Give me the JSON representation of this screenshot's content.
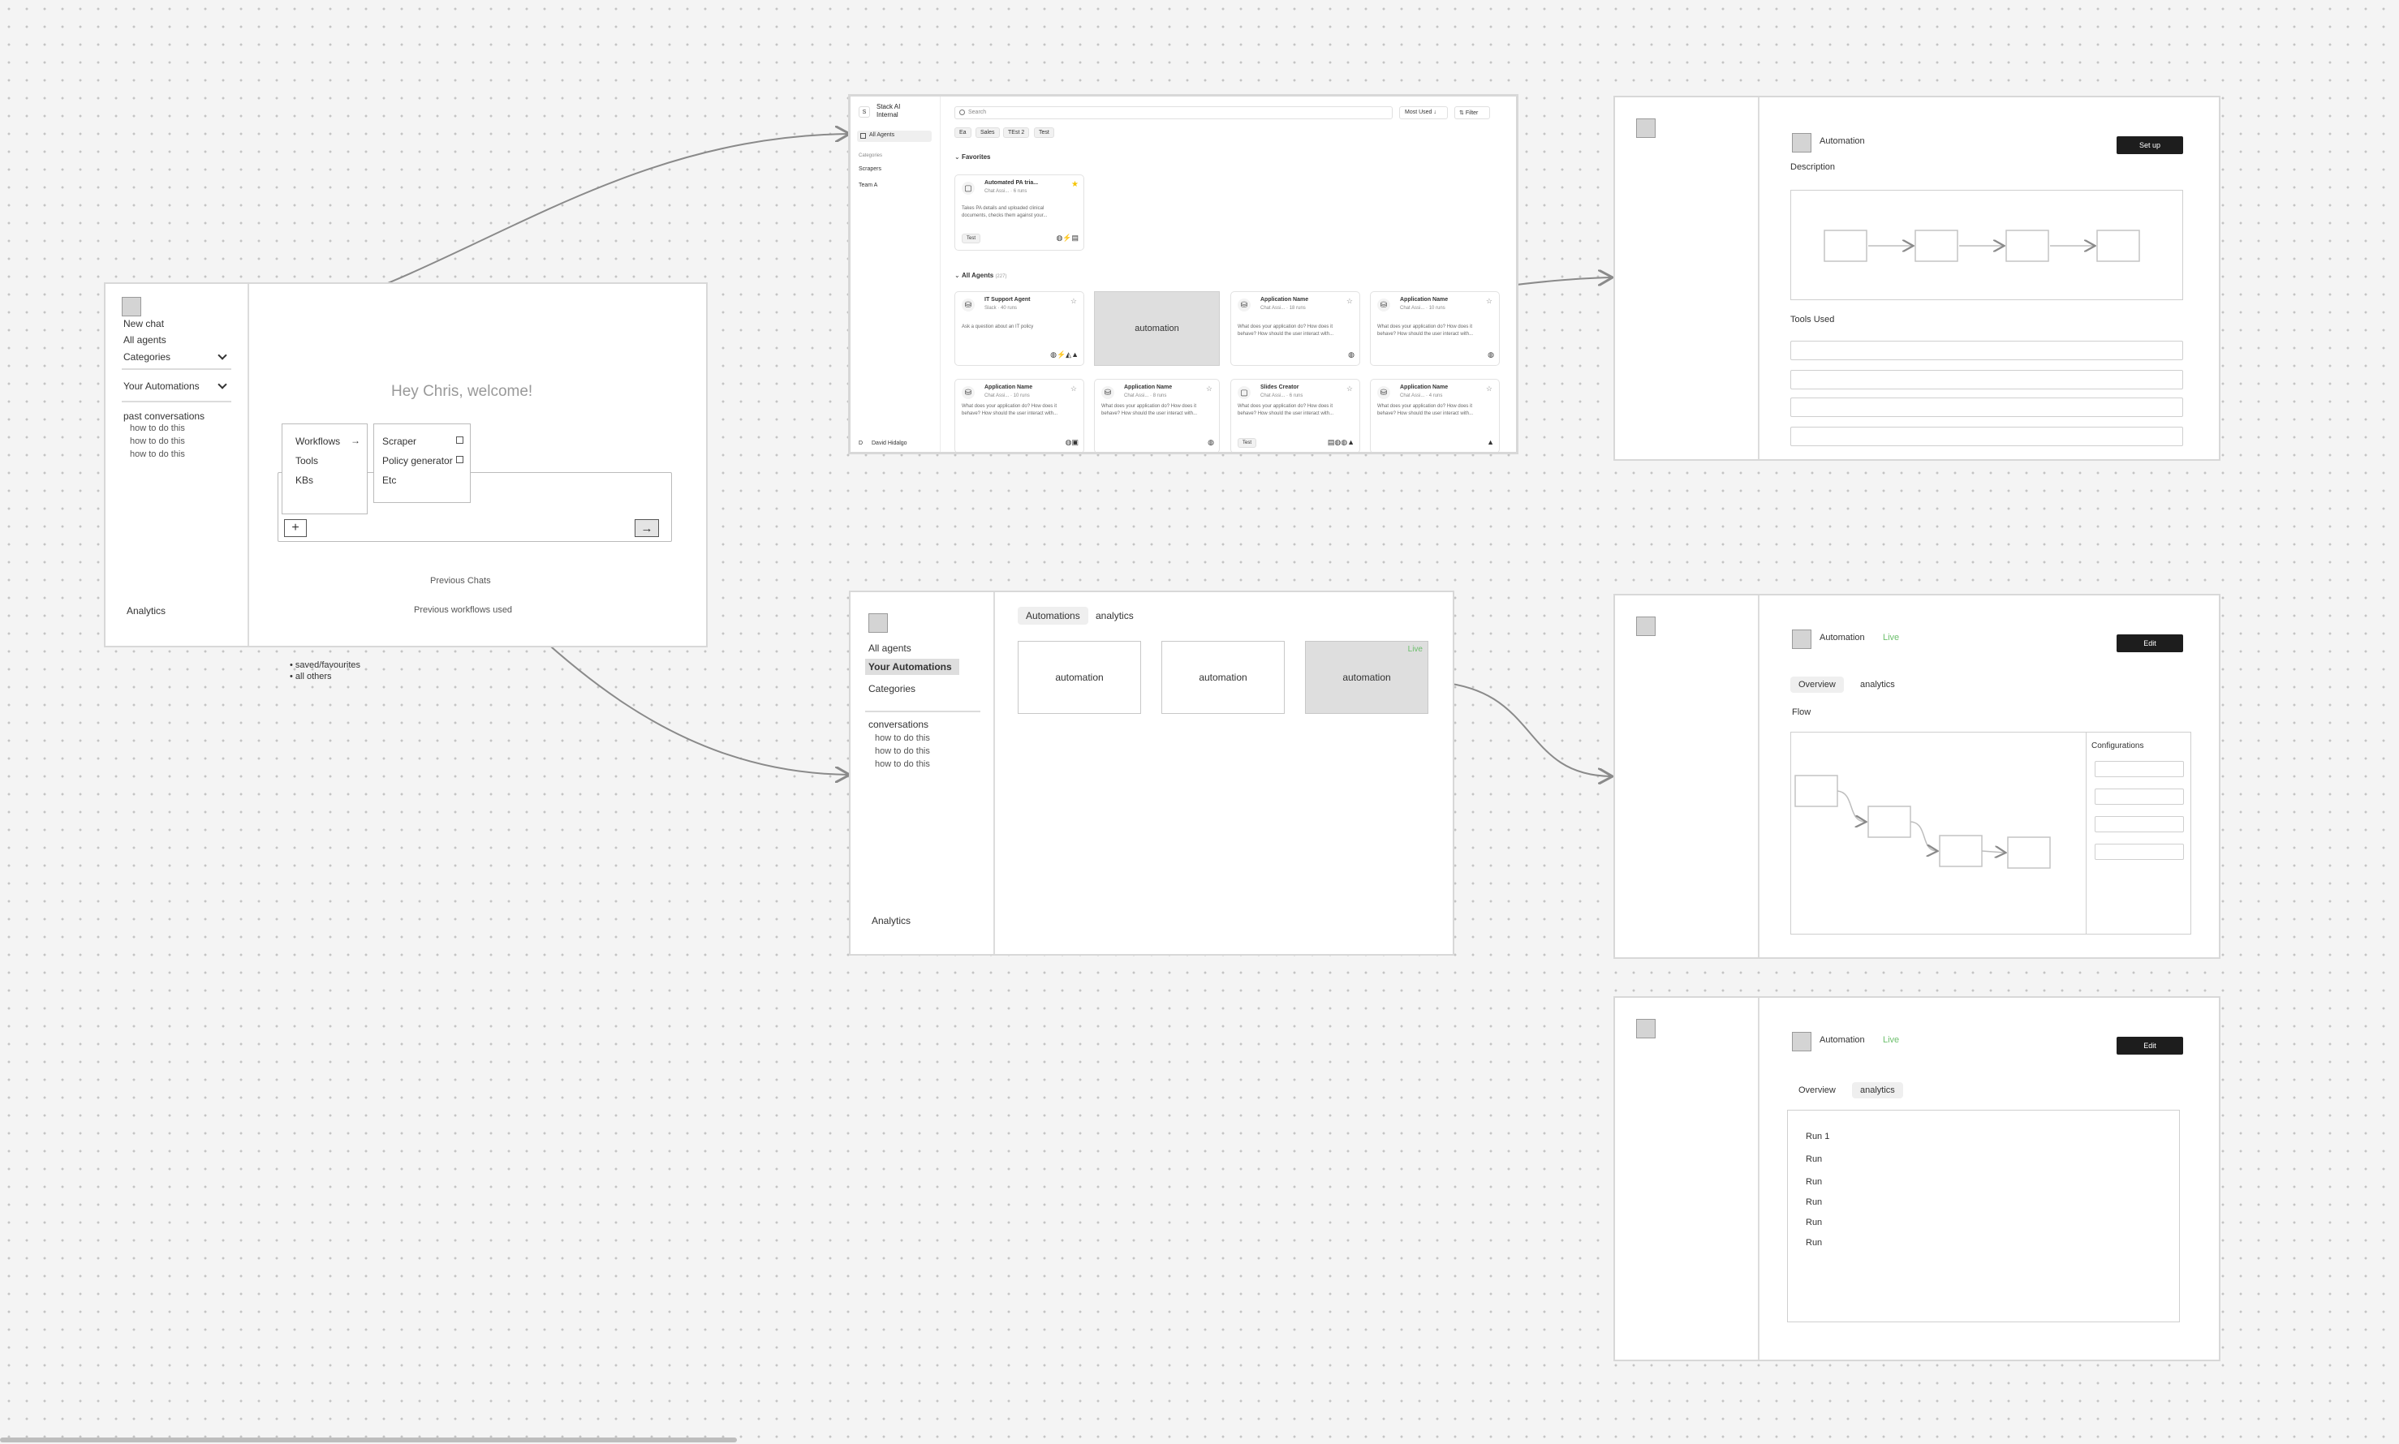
{
  "frame_chat": {
    "new_chat": "New chat",
    "all_agents": "All agents",
    "categories": "Categories",
    "your_automations": "Your Automations",
    "past_conversations": "past conversations",
    "conv_items": [
      "how to do this",
      "how to do this",
      "how to do this"
    ],
    "analytics": "Analytics",
    "welcome": "Hey Chris, welcome!",
    "menu_items": [
      "Workflows",
      "Tools",
      "KBs"
    ],
    "submenu_items": [
      "Scraper",
      "Policy generator",
      "Etc"
    ],
    "previous_chats": "Previous Chats",
    "previous_workflows": "Previous workflows used",
    "notes": [
      "saved/favourites",
      "all others"
    ]
  },
  "frame_agents": {
    "org_initial": "S",
    "org_name_1": "Stack AI",
    "org_name_2": "Internal",
    "nav_all_agents": "All Agents",
    "categories_label": "Categories",
    "cat_items": [
      "Scrapers",
      "Team A"
    ],
    "user_initial": "D",
    "user_name": "David Hidalgo",
    "search_placeholder": "Search",
    "sort_label": "Most Used",
    "filter_label": "Filter",
    "chips": [
      "Ea",
      "Sales",
      "TEst 2",
      "Test"
    ],
    "favorites_label": "Favorites",
    "all_agents_label": "All Agents",
    "all_agents_count": "(227)",
    "fav_card": {
      "title": "Automated PA tria...",
      "meta_type": "Chat Assi...",
      "meta_runs": "6 runs",
      "desc_1": "Takes PA details and uploaded clinical",
      "desc_2": "documents, checks them against your...",
      "tag": "Test"
    },
    "automation_label": "automation",
    "cards": [
      {
        "title": "IT Support Agent",
        "meta_type": "Slack",
        "meta_runs": "40 runs",
        "desc_1": "Ask a question about an IT policy",
        "desc_2": ""
      },
      {
        "title": "Application Name",
        "meta_type": "Chat Assi...",
        "meta_runs": "18 runs",
        "desc_1": "What does your application do? How does it",
        "desc_2": "behave? How should the user interact with..."
      },
      {
        "title": "Application Name",
        "meta_type": "Chat Assi...",
        "meta_runs": "10 runs",
        "desc_1": "What does your application do? How does it",
        "desc_2": "behave? How should the user interact with..."
      },
      {
        "title": "Application Name",
        "meta_type": "Chat Assi...",
        "meta_runs": "10 runs",
        "desc_1": "What does your application do? How does it",
        "desc_2": "behave? How should the user interact with..."
      },
      {
        "title": "Application Name",
        "meta_type": "Chat Assi...",
        "meta_runs": "8 runs",
        "desc_1": "What does your application do? How does it",
        "desc_2": "behave? How should the user interact with..."
      },
      {
        "title": "Slides Creator",
        "meta_type": "Chat Assi...",
        "meta_runs": "6 runs",
        "desc_1": "What does your application do? How does it",
        "desc_2": "behave? How should the user interact with...",
        "tag": "Test"
      },
      {
        "title": "Application Name",
        "meta_type": "Chat Assi...",
        "meta_runs": "4 runs",
        "desc_1": "What does your application do? How does it",
        "desc_2": "behave? How should the user interact with..."
      }
    ]
  },
  "frame_automations": {
    "all_agents": "All agents",
    "your_automations": "Your Automations",
    "categories": "Categories",
    "conversations": "conversations",
    "conv_items": [
      "how to do this",
      "how to do this",
      "how to do this"
    ],
    "analytics": "Analytics",
    "tab_automations": "Automations",
    "tab_analytics": "analytics",
    "cards": [
      "automation",
      "automation",
      "automation"
    ],
    "live": "Live"
  },
  "frame_setup": {
    "title": "Automation",
    "setup_button": "Set up",
    "description": "Description",
    "tools_used": "Tools Used"
  },
  "frame_overview": {
    "title": "Automation",
    "live": "Live",
    "edit_button": "Edit",
    "tab_overview": "Overview",
    "tab_analytics": "analytics",
    "flow": "Flow",
    "configurations": "Configurations"
  },
  "frame_analytics": {
    "title": "Automation",
    "live": "Live",
    "edit_button": "Edit",
    "tab_overview": "Overview",
    "tab_analytics": "analytics",
    "runs": [
      "Run 1",
      "Run",
      "Run",
      "Run",
      "Run",
      "Run"
    ]
  },
  "colors": {
    "live_green": "#6cbf6c",
    "dark_button": "#1d1d1d",
    "highlight_gray": "#dedede",
    "star_yellow": "#f5c400"
  },
  "icons": [
    "star-icon",
    "search-icon",
    "filter-icon",
    "chevron-down-icon",
    "plus-icon",
    "arrow-right-icon",
    "chat-icon",
    "agent-icon"
  ]
}
